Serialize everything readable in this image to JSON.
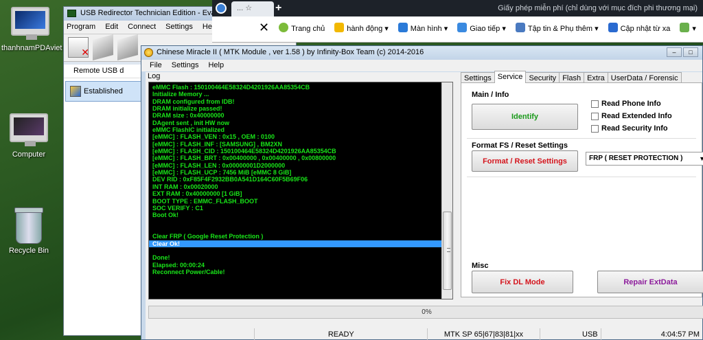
{
  "desktop": {
    "icons": [
      {
        "label": "thanhnamPDAviet"
      },
      {
        "label": "Computer"
      },
      {
        "label": "Recycle Bin"
      }
    ]
  },
  "usb_window": {
    "title": "USB Redirector Technician Edition - Evaluatio",
    "menu": [
      "Program",
      "Edit",
      "Connect",
      "Settings",
      "Help"
    ],
    "remote_label": "Remote USB d",
    "connection_status": "Established"
  },
  "browser": {
    "tab_label": "...",
    "notice": "Giấy phép miễn phí (chỉ dùng với mục đích phi thương mại)",
    "toolbar": [
      {
        "label": "",
        "icon": "close-icon"
      },
      {
        "label": "Trang chủ",
        "icon": "home-icon"
      },
      {
        "label": "hành động",
        "icon": "action-icon"
      },
      {
        "label": "Màn hình",
        "icon": "monitor-icon"
      },
      {
        "label": "Giao tiếp",
        "icon": "communicate-icon"
      },
      {
        "label": "Tập tin & Phụ thêm",
        "icon": "files-icon"
      },
      {
        "label": "Cập nhật từ xa",
        "icon": "download-icon"
      }
    ]
  },
  "cm": {
    "title": "Chinese Miracle II ( MTK Module , ver 1.58 ) by Infinity-Box Team (c) 2014-2016",
    "menu": [
      "File",
      "Settings",
      "Help"
    ],
    "log_label": "Log",
    "log_lines": [
      "eMMC Flash : 150100464E58324D4201926AA85354CB",
      "Initialize Memory ...",
      "DRAM configured from IDB!",
      "DRAM initialize passed!",
      "DRAM size : 0x40000000",
      "DAgent sent , init HW now",
      "eMMC FlashIC initialized",
      "[eMMC] : FLASH_VEN : 0x15 , OEM : 0100",
      "[eMMC] : FLASH_INF : [SAMSUNG] , BM2XN",
      "[eMMC] : FLASH_CID : 150100464E58324D4201926AA85354CB",
      "[eMMC] : FLASH_BRT : 0x00400000 , 0x00400000 , 0x00800000",
      "[eMMC] : FLASH_LEN : 0x00000001D2000000",
      "[eMMC] : FLASH_UCP : 7456 MiB [eMMC 8 GiB]",
      "DEV RID    : 0xF85F4F2932BB0A541D164C60F5B69F06",
      "INT RAM    : 0x00020000",
      "EXT RAM    : 0x40000000 [1 GiB]",
      "BOOT TYPE  : EMMC_FLASH_BOOT",
      "SOC VERIFY : C1",
      "Boot Ok!",
      "",
      "",
      "Clear FRP ( Google Reset Protection )",
      "Clear Ok!",
      "",
      "Done!",
      "Elapsed: 00:00:24",
      "Reconnect Power/Cable!"
    ],
    "selected_line_index": 22,
    "tabs": [
      "Settings",
      "Service",
      "Security",
      "Flash",
      "Extra",
      "UserData / Forensic"
    ],
    "active_tab": "Service",
    "main_info": {
      "title": "Main / Info",
      "identify_label": "Identify",
      "checkboxes": [
        {
          "label": "Read Phone Info",
          "checked": false
        },
        {
          "label": "Read Extended Info",
          "checked": false
        },
        {
          "label": "Read Security Info",
          "checked": false
        }
      ]
    },
    "format": {
      "title": "Format FS / Reset Settings",
      "button_label": "Format / Reset Settings",
      "select_value": "FRP ( RESET PROTECTION )"
    },
    "misc": {
      "title": "Misc",
      "fix_dl_label": "Fix DL Mode",
      "repair_label": "Repair ExtData"
    },
    "progress_percent": 0,
    "progress_text": "0%",
    "status": {
      "state": "READY",
      "port_info": "MTK SP 65|67|83|81|xx",
      "connection": "USB",
      "time": "4:04:57 PM"
    },
    "colors": {
      "log_text": "#19e619",
      "red_button_text": "#d4141c",
      "green_button_text": "#1a9a1a",
      "purple_button_text": "#8b1a9a",
      "selection": "#3399ff"
    }
  }
}
